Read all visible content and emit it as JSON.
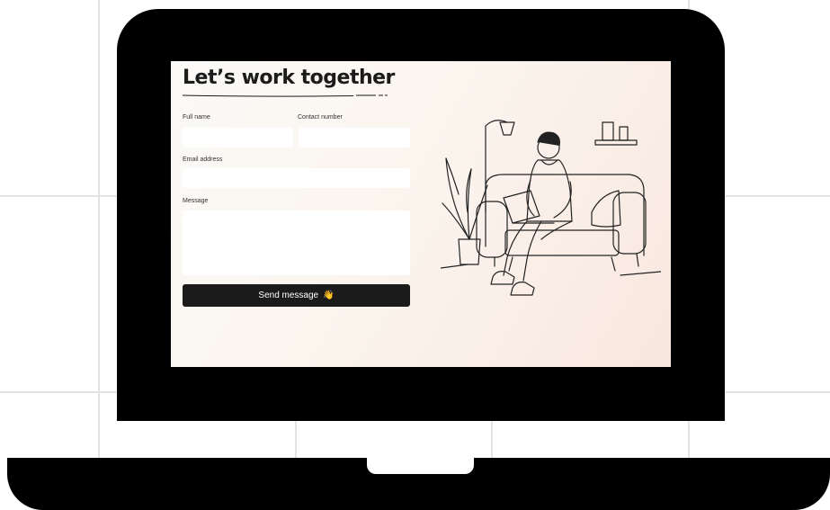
{
  "form": {
    "heading": "Let’s work together",
    "full_name_label": "Full name",
    "contact_number_label": "Contact number",
    "email_label": "Email address",
    "message_label": "Message",
    "full_name_value": "",
    "contact_number_value": "",
    "email_value": "",
    "message_value": "",
    "send_label": "Send message",
    "send_icon": "waving-hand-icon",
    "send_emoji": "👋"
  },
  "illustration": {
    "subject": "person-with-laptop-on-sofa"
  },
  "colors": {
    "button_bg": "#1b1b1b",
    "button_text": "#ffffff",
    "screen_bg_start": "#fbfaf8",
    "screen_bg_end": "#f8e7df",
    "laptop_frame": "#000000"
  }
}
